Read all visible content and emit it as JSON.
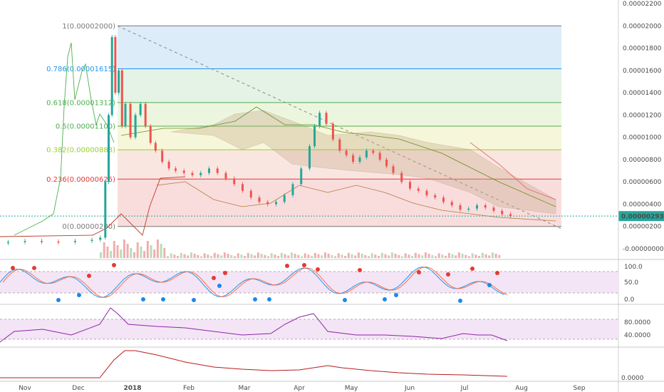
{
  "chart_data": {
    "type": "candlestick",
    "price_axis_ticks": [
      "0.00002200",
      "0.00002000",
      "0.00001800",
      "0.00001600",
      "0.00001400",
      "0.00001200",
      "0.00001000",
      "0.00000800",
      "0.00000600",
      "0.00000400",
      "0.00000200",
      "0.00000000"
    ],
    "price_axis_ticks_values": [
      2.2e-05,
      2e-05,
      1.8e-05,
      1.6e-05,
      1.4e-05,
      1.2e-05,
      1e-05,
      8e-06,
      6e-06,
      4e-06,
      2e-06,
      0.0
    ],
    "last_price": "0.00000293",
    "last_price_value": 2.93e-06,
    "fib_levels": [
      {
        "label": "1(0.00002000)",
        "value": 2e-05,
        "color": "#787878",
        "fill": "#e6e6e6"
      },
      {
        "label": "0.786(0.00001615)",
        "value": 1.615e-05,
        "color": "#2196f3",
        "fill": "#d6e9f8"
      },
      {
        "label": "0.618(0.00001312)",
        "value": 1.312e-05,
        "color": "#4caf50",
        "fill": "#dff1e0"
      },
      {
        "label": "0.5(0.00001100)",
        "value": 1.1e-05,
        "color": "#4caf50",
        "fill": "#e9f5d8"
      },
      {
        "label": "0.382(0.00000888)",
        "value": 8.88e-06,
        "color": "#9acd32",
        "fill": "#f4f6d3"
      },
      {
        "label": "0.236(0.00000625)",
        "value": 6.25e-06,
        "color": "#e53935",
        "fill": "#f9e2dc"
      },
      {
        "label": "0(0.00000200)",
        "value": 2e-06,
        "color": "#787878",
        "fill": "#f8d7d7"
      }
    ],
    "x_axis_labels": [
      "Nov",
      "Dec",
      "2018",
      "Feb",
      "Mar",
      "Apr",
      "May",
      "Jun",
      "Jul",
      "Aug",
      "Sep"
    ],
    "stoch_ticks": [
      "100.0",
      "50.0",
      "0.0"
    ],
    "rsi_ticks": [
      "80.0000",
      "40.0000"
    ],
    "bottom_tick": "0.0000",
    "price_series": [
      {
        "d": 0,
        "c": 6e-07
      },
      {
        "d": 10,
        "c": 7e-07
      },
      {
        "d": 20,
        "c": 6.5e-07
      },
      {
        "d": 30,
        "c": 6e-07
      },
      {
        "d": 40,
        "c": 7e-07
      },
      {
        "d": 50,
        "c": 8e-07
      },
      {
        "d": 55,
        "c": 1e-06
      },
      {
        "d": 58,
        "c": 6e-06
      },
      {
        "d": 60,
        "c": 1.2e-05
      },
      {
        "d": 62,
        "c": 1.9e-05
      },
      {
        "d": 64,
        "c": 1.4e-05
      },
      {
        "d": 66,
        "c": 1.6e-05
      },
      {
        "d": 68,
        "c": 1.1e-05
      },
      {
        "d": 70,
        "c": 1.3e-05
      },
      {
        "d": 73,
        "c": 1e-05
      },
      {
        "d": 76,
        "c": 1.2e-05
      },
      {
        "d": 79,
        "c": 1.3e-05
      },
      {
        "d": 82,
        "c": 1.1e-05
      },
      {
        "d": 85,
        "c": 9.5e-06
      },
      {
        "d": 88,
        "c": 8.8e-06
      },
      {
        "d": 92,
        "c": 7.8e-06
      },
      {
        "d": 96,
        "c": 7.2e-06
      },
      {
        "d": 100,
        "c": 7e-06
      },
      {
        "d": 105,
        "c": 6.8e-06
      },
      {
        "d": 110,
        "c": 6.6e-06
      },
      {
        "d": 115,
        "c": 6.8e-06
      },
      {
        "d": 120,
        "c": 7.2e-06
      },
      {
        "d": 125,
        "c": 6.8e-06
      },
      {
        "d": 130,
        "c": 6.3e-06
      },
      {
        "d": 135,
        "c": 5.8e-06
      },
      {
        "d": 140,
        "c": 5.2e-06
      },
      {
        "d": 145,
        "c": 4.6e-06
      },
      {
        "d": 150,
        "c": 4.2e-06
      },
      {
        "d": 155,
        "c": 4e-06
      },
      {
        "d": 160,
        "c": 4.2e-06
      },
      {
        "d": 165,
        "c": 4.8e-06
      },
      {
        "d": 170,
        "c": 5.8e-06
      },
      {
        "d": 175,
        "c": 7.2e-06
      },
      {
        "d": 180,
        "c": 9.2e-06
      },
      {
        "d": 183,
        "c": 1.1e-05
      },
      {
        "d": 186,
        "c": 1.22e-05
      },
      {
        "d": 190,
        "c": 1.12e-05
      },
      {
        "d": 194,
        "c": 9.8e-06
      },
      {
        "d": 198,
        "c": 8.8e-06
      },
      {
        "d": 202,
        "c": 8.4e-06
      },
      {
        "d": 206,
        "c": 7.8e-06
      },
      {
        "d": 210,
        "c": 8.2e-06
      },
      {
        "d": 214,
        "c": 8.8e-06
      },
      {
        "d": 218,
        "c": 8.6e-06
      },
      {
        "d": 222,
        "c": 8e-06
      },
      {
        "d": 226,
        "c": 7.4e-06
      },
      {
        "d": 230,
        "c": 6.8e-06
      },
      {
        "d": 235,
        "c": 6e-06
      },
      {
        "d": 240,
        "c": 5.4e-06
      },
      {
        "d": 245,
        "c": 5.2e-06
      },
      {
        "d": 250,
        "c": 4.8e-06
      },
      {
        "d": 255,
        "c": 4.6e-06
      },
      {
        "d": 260,
        "c": 4.2e-06
      },
      {
        "d": 265,
        "c": 3.9e-06
      },
      {
        "d": 270,
        "c": 3.5e-06
      },
      {
        "d": 275,
        "c": 3.6e-06
      },
      {
        "d": 280,
        "c": 3.9e-06
      },
      {
        "d": 285,
        "c": 3.7e-06
      },
      {
        "d": 290,
        "c": 3.4e-06
      },
      {
        "d": 295,
        "c": 3.1e-06
      },
      {
        "d": 300,
        "c": 2.93e-06
      }
    ]
  }
}
